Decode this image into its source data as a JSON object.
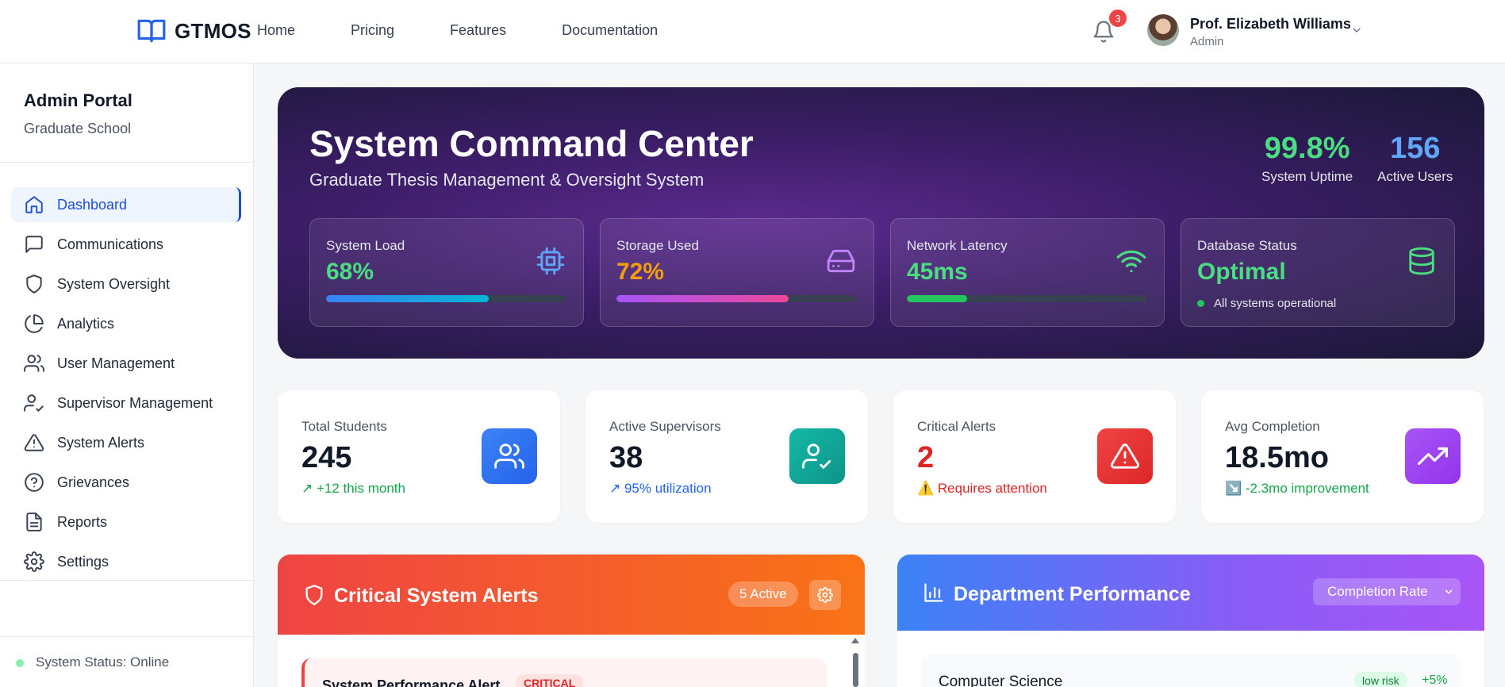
{
  "brand": {
    "name": "GTMOS"
  },
  "topnav": {
    "items": [
      "Home",
      "Pricing",
      "Features",
      "Documentation"
    ]
  },
  "notifications": {
    "count": "3"
  },
  "user": {
    "name": "Prof. Elizabeth Williams",
    "role": "Admin"
  },
  "sidebar": {
    "title": "Admin Portal",
    "subtitle": "Graduate School",
    "items": [
      {
        "label": "Dashboard",
        "icon": "home-icon",
        "active": true
      },
      {
        "label": "Communications",
        "icon": "chat-icon"
      },
      {
        "label": "System Oversight",
        "icon": "shield-icon"
      },
      {
        "label": "Analytics",
        "icon": "pie-chart-icon"
      },
      {
        "label": "User Management",
        "icon": "users-icon"
      },
      {
        "label": "Supervisor Management",
        "icon": "user-check-icon"
      },
      {
        "label": "System Alerts",
        "icon": "warning-icon"
      },
      {
        "label": "Grievances",
        "icon": "help-circle-icon"
      },
      {
        "label": "Reports",
        "icon": "document-icon"
      },
      {
        "label": "Settings",
        "icon": "gear-icon"
      }
    ],
    "status": "System Status: Online"
  },
  "hero": {
    "title": "System Command Center",
    "subtitle": "Graduate Thesis Management & Oversight System",
    "stats": [
      {
        "value": "99.8%",
        "label": "System Uptime",
        "color": "#4ade80"
      },
      {
        "value": "156",
        "label": "Active Users",
        "color": "#60a5fa"
      }
    ],
    "metrics": [
      {
        "label": "System Load",
        "value": "68%",
        "percent": 68,
        "color": "#4ade80",
        "icon": "cpu-icon"
      },
      {
        "label": "Storage Used",
        "value": "72%",
        "percent": 72,
        "color": "#f59e0b",
        "icon": "hard-drive-icon"
      },
      {
        "label": "Network Latency",
        "value": "45ms",
        "percent": 25,
        "color": "#4ade80",
        "icon": "wifi-icon"
      },
      {
        "label": "Database Status",
        "value": "Optimal",
        "note": "All systems operational",
        "color": "#4ade80",
        "icon": "database-icon"
      }
    ]
  },
  "stat_cards": [
    {
      "label": "Total Students",
      "value": "245",
      "trend": "↗ +12 this month",
      "trend_color": "#16a34a",
      "icon": "users-icon"
    },
    {
      "label": "Active Supervisors",
      "value": "38",
      "trend": "↗ 95% utilization",
      "trend_color": "#2563eb",
      "icon": "user-check-icon"
    },
    {
      "label": "Critical Alerts",
      "value": "2",
      "trend": "⚠️ Requires attention",
      "trend_color": "#dc2626",
      "icon": "warning-icon"
    },
    {
      "label": "Avg Completion",
      "value": "18.5mo",
      "trend": "↘️ -2.3mo improvement",
      "trend_color": "#16a34a",
      "icon": "trending-up-icon"
    }
  ],
  "alerts_panel": {
    "title": "Critical System Alerts",
    "active_count": "5 Active",
    "items": [
      {
        "title": "System Performance Alert",
        "severity": "CRITICAL"
      }
    ]
  },
  "performance_panel": {
    "title": "Department Performance",
    "metric_select": "Completion Rate",
    "rows": [
      {
        "department": "Computer Science",
        "risk": "low risk",
        "delta": "+5%"
      }
    ]
  }
}
